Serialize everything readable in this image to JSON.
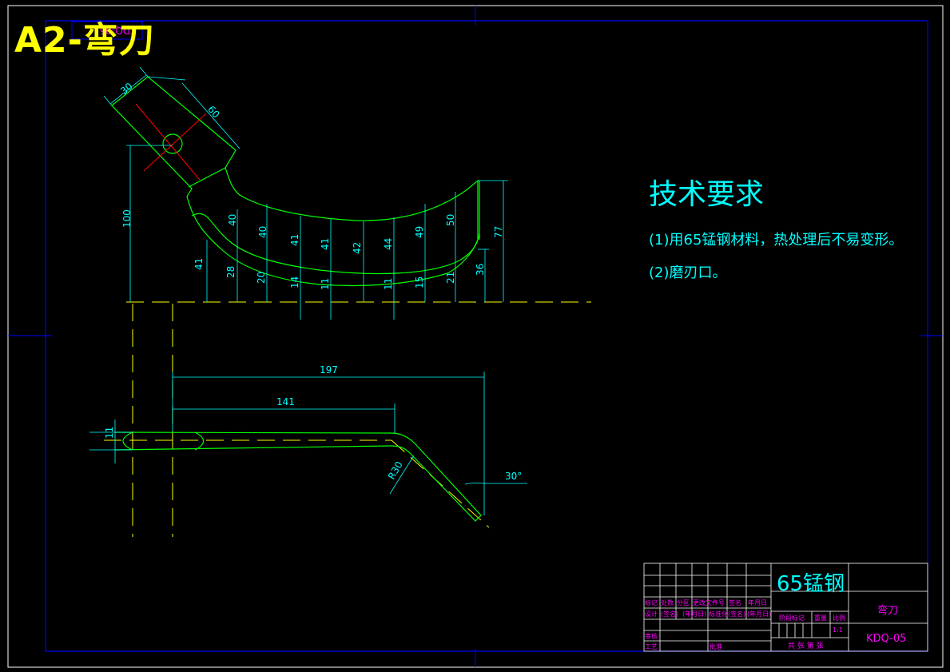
{
  "sheet": {
    "title": "A2-弯刀",
    "stamp_text": "KDQ-05"
  },
  "technical_requirements": {
    "heading": "技术要求",
    "items": [
      "(1)用65锰钢材料，热处理后不易变形。",
      "(2)磨刃口。"
    ]
  },
  "dimensions": {
    "top_30": "30",
    "top_60": "60",
    "height_100": "100",
    "upper": [
      "40",
      "40",
      "41",
      "41",
      "42",
      "44",
      "49",
      "50",
      "77"
    ],
    "lower": [
      "41",
      "28",
      "20",
      "14",
      "11",
      "11",
      "15",
      "21",
      "36"
    ],
    "len_197": "197",
    "len_141": "141",
    "thick_11": "11",
    "radius": "R30",
    "angle": "30°"
  },
  "title_block": {
    "material": "65锰钢",
    "part_name": "弯刀",
    "drawing_no": "KDQ-05",
    "scale": "1:1",
    "labels": {
      "mark": "标记",
      "count": "处数",
      "zone": "分区",
      "change_doc": "更改文件号",
      "sign": "签名",
      "date": "年月日",
      "design": "设计",
      "sign2": "(签名)",
      "date2": "(年月日)",
      "standard": "标准化",
      "sign3": "(签名)",
      "date3": "(年月日)",
      "stage_mark": "阶段标记",
      "weight": "重量",
      "ratio": "比例",
      "review": "审核",
      "process": "工艺",
      "approve": "批准",
      "sheets": "共  张 第  张"
    }
  },
  "colors": {
    "frame": "#0000ff",
    "outline": "#00ff00",
    "dimension": "#00ffff",
    "centerline": "#ffff00",
    "center_mark": "#ff0000",
    "title_text": "#ffff00",
    "block_text": "#ff00ff",
    "block_lines": "#ffffff"
  }
}
